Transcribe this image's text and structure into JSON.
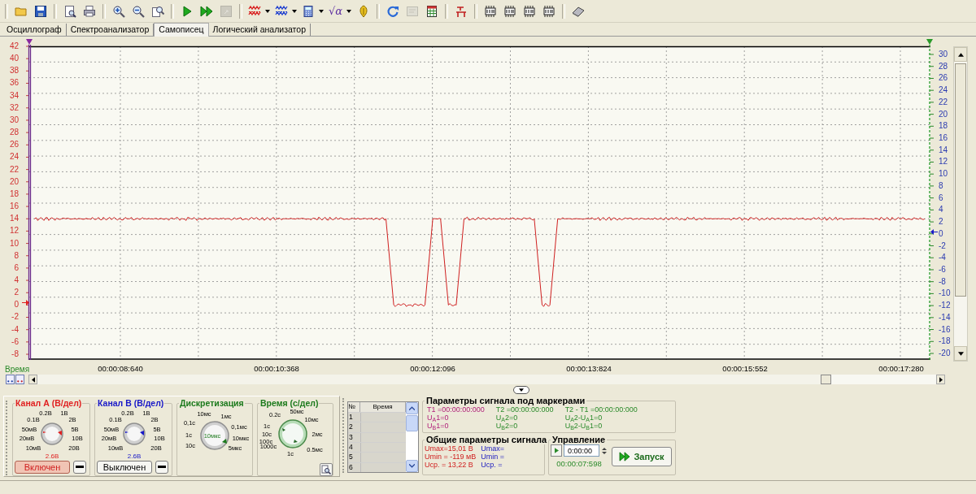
{
  "toolbar": [
    [
      {
        "kind": "folder",
        "disabled": false
      },
      {
        "kind": "floppy",
        "disabled": false
      }
    ],
    [
      {
        "kind": "preview",
        "disabled": false
      },
      {
        "kind": "printer",
        "disabled": false
      }
    ],
    [
      {
        "kind": "zoom-in",
        "disabled": false
      },
      {
        "kind": "zoom-out",
        "disabled": false
      },
      {
        "kind": "zoom-page",
        "disabled": false
      }
    ],
    [
      {
        "kind": "play",
        "disabled": false
      },
      {
        "kind": "fast-play",
        "disabled": false
      },
      {
        "kind": "stop",
        "disabled": true
      }
    ],
    [
      {
        "kind": "wave-red",
        "disabled": false,
        "dropdown": true
      },
      {
        "kind": "wave-blue",
        "disabled": false,
        "dropdown": true
      },
      {
        "kind": "calculator",
        "disabled": false,
        "dropdown": true
      },
      {
        "kind": "glyph",
        "label": "√α",
        "disabled": false,
        "dropdown": true
      },
      {
        "kind": "probe",
        "disabled": false
      }
    ],
    [
      {
        "kind": "refresh",
        "disabled": false
      },
      {
        "kind": "sheet",
        "disabled": true
      },
      {
        "kind": "table",
        "disabled": false
      }
    ],
    [
      {
        "kind": "antenna",
        "disabled": false
      }
    ],
    [
      {
        "kind": "chip",
        "disabled": false
      },
      {
        "kind": "chip",
        "disabled": false
      },
      {
        "kind": "chip",
        "disabled": false
      },
      {
        "kind": "chip",
        "disabled": false
      }
    ],
    [
      {
        "kind": "eraser",
        "disabled": false
      }
    ]
  ],
  "tabs": [
    {
      "label": "Осциллограф",
      "selected": false
    },
    {
      "label": "Спектроанализатор",
      "selected": false
    },
    {
      "label": "Самописец",
      "selected": true
    },
    {
      "label": "Логический анализатор",
      "selected": false
    }
  ],
  "chart": {
    "chart_data": {
      "type": "line",
      "xlabel": "Время",
      "categories": [
        null,
        null,
        null,
        null,
        null,
        null,
        null,
        null,
        null,
        null,
        null,
        "00:00:08:640",
        null,
        null,
        null,
        null,
        null,
        null,
        null,
        null,
        null,
        null,
        null,
        null,
        null,
        null,
        null,
        null,
        null,
        null,
        null,
        "00:00:10:368",
        null,
        null,
        null,
        null,
        null,
        null,
        null,
        null,
        null,
        null,
        null,
        null,
        null,
        null,
        null,
        null,
        null,
        null,
        null,
        "00:00:12:096",
        null,
        null,
        null,
        null,
        null,
        null,
        null,
        null,
        null,
        null,
        null,
        null,
        null,
        null,
        null,
        null,
        null,
        null,
        null,
        "00:00:13:824",
        null,
        null,
        null,
        null,
        null,
        null,
        null,
        null,
        null,
        null,
        null,
        null,
        null,
        null,
        null,
        null,
        null,
        null,
        null,
        "00:00:15:552",
        null,
        null,
        null,
        null,
        null,
        null,
        null,
        null,
        null,
        null,
        null,
        null,
        null,
        null,
        null,
        null,
        null,
        null,
        null,
        "00:00:17:280",
        null,
        null,
        null
      ],
      "series": [
        {
          "color": "#d02020",
          "values": [
            14,
            14,
            14,
            14,
            14,
            14,
            14,
            14,
            14,
            14,
            14,
            14,
            14,
            14,
            14,
            14,
            14,
            14,
            14,
            14,
            14,
            14,
            14,
            14,
            14,
            14,
            14,
            14,
            14,
            14,
            14,
            14,
            14,
            14,
            14,
            14,
            14,
            14,
            14,
            14,
            14,
            14,
            14,
            14,
            14,
            14,
            0,
            0,
            0,
            0,
            0,
            14,
            14,
            0,
            0,
            14,
            14,
            14,
            14,
            14,
            14,
            14,
            14,
            14,
            14,
            0,
            0,
            14,
            14,
            14,
            14,
            14,
            14,
            14,
            14,
            14,
            14,
            14,
            14,
            14,
            14,
            14,
            14,
            14,
            14,
            14,
            14,
            14,
            14,
            14,
            14,
            14,
            14,
            14,
            14,
            14,
            14,
            14,
            14,
            14,
            14,
            14,
            14,
            14,
            14,
            14,
            14,
            14,
            14,
            14,
            14,
            14,
            14,
            14,
            14
          ]
        }
      ],
      "ylim": [
        -8.92,
        42
      ],
      "grid": true,
      "yticks": [
        42,
        40,
        38,
        36,
        34,
        32,
        30,
        28,
        26,
        24,
        22,
        20,
        18,
        16,
        14,
        12,
        10,
        8,
        6,
        4,
        2,
        0,
        -2,
        -4,
        -6,
        -8
      ]
    },
    "right_axis": [
      "30",
      "28",
      "26",
      "24",
      "22",
      "20",
      "18",
      "16",
      "14",
      "12",
      "10",
      "8",
      "6",
      "4",
      "2",
      "0",
      "-2",
      "-4",
      "-6",
      "-8",
      "-10",
      "-12",
      "-14",
      "-16",
      "-18",
      "-20"
    ]
  },
  "controls": [
    {
      "kind": "channel",
      "title": "Канал А (В/дел)",
      "color": "#e02020",
      "scale": [
        "0.2В",
        "1В",
        "0.1В",
        "2В",
        "50мВ",
        "5В",
        "20мВ",
        "10В",
        "10мВ",
        "20В"
      ],
      "value": "2.6В",
      "toggle": {
        "label": "Включен",
        "on": true
      }
    },
    {
      "kind": "channel",
      "title": "Канал В (В/дел)",
      "color": "#1818c8",
      "scale": [
        "0.2В",
        "1В",
        "0.1В",
        "2В",
        "50мВ",
        "5В",
        "20мВ",
        "10В",
        "10мВ",
        "20В"
      ],
      "value": "2.6В",
      "toggle": {
        "label": "Выключен",
        "on": false
      }
    },
    {
      "kind": "sampling",
      "title": "Дискретизация",
      "color": "#1c7a1c",
      "scale": [
        "10мс",
        "1мс",
        "0,1с",
        "0,1мс",
        "1с",
        "10мкс",
        "10с",
        "5мкс"
      ],
      "value": "10мкс"
    },
    {
      "kind": "time",
      "title": "Время (с/дел)",
      "color": "#1c7a1c",
      "scale": [
        "0.2с",
        "50мс",
        "10мс",
        "1с",
        "10с",
        "2мс",
        "100с",
        "1000с",
        "0.5мс",
        "1с"
      ]
    }
  ],
  "marker_table": {
    "columns": [
      "№",
      "Время"
    ],
    "rows": [
      "1",
      "2",
      "3",
      "4",
      "5",
      "6"
    ]
  },
  "marker_params": {
    "title": "Параметры сигнала под маркерами",
    "columns": [
      {
        "kind": "first",
        "lines": [
          "T1 =00:00:00:000",
          "U$_{A}$1=0",
          "U$_{B}$1=0"
        ]
      },
      {
        "kind": "second",
        "lines": [
          "T2 =00:00:00:000",
          "U$_{A}$2=0",
          "U$_{B}$2=0"
        ]
      },
      {
        "kind": "difference",
        "lines": [
          "T2 - T1 =00:00:00:000",
          "U$_{A}$2-U$_{A}$1=0",
          "U$_{B}$2-U$_{B}$1=0"
        ]
      }
    ]
  },
  "signal_params": {
    "title": "Общие параметры сигнала",
    "columns": [
      {
        "kind": "channel_a",
        "lines": [
          "Umax=15,01 В",
          "Umin = -119 мВ",
          "Uср. = 13,22 В"
        ]
      },
      {
        "kind": "channel_b",
        "lines": [
          "Umax=",
          "Umin =",
          "Uср. ="
        ]
      }
    ]
  },
  "control": {
    "title": "Управление",
    "time_field": "0:00:00",
    "elapsed": "00:00:07:598",
    "start_button": "Запуск"
  }
}
